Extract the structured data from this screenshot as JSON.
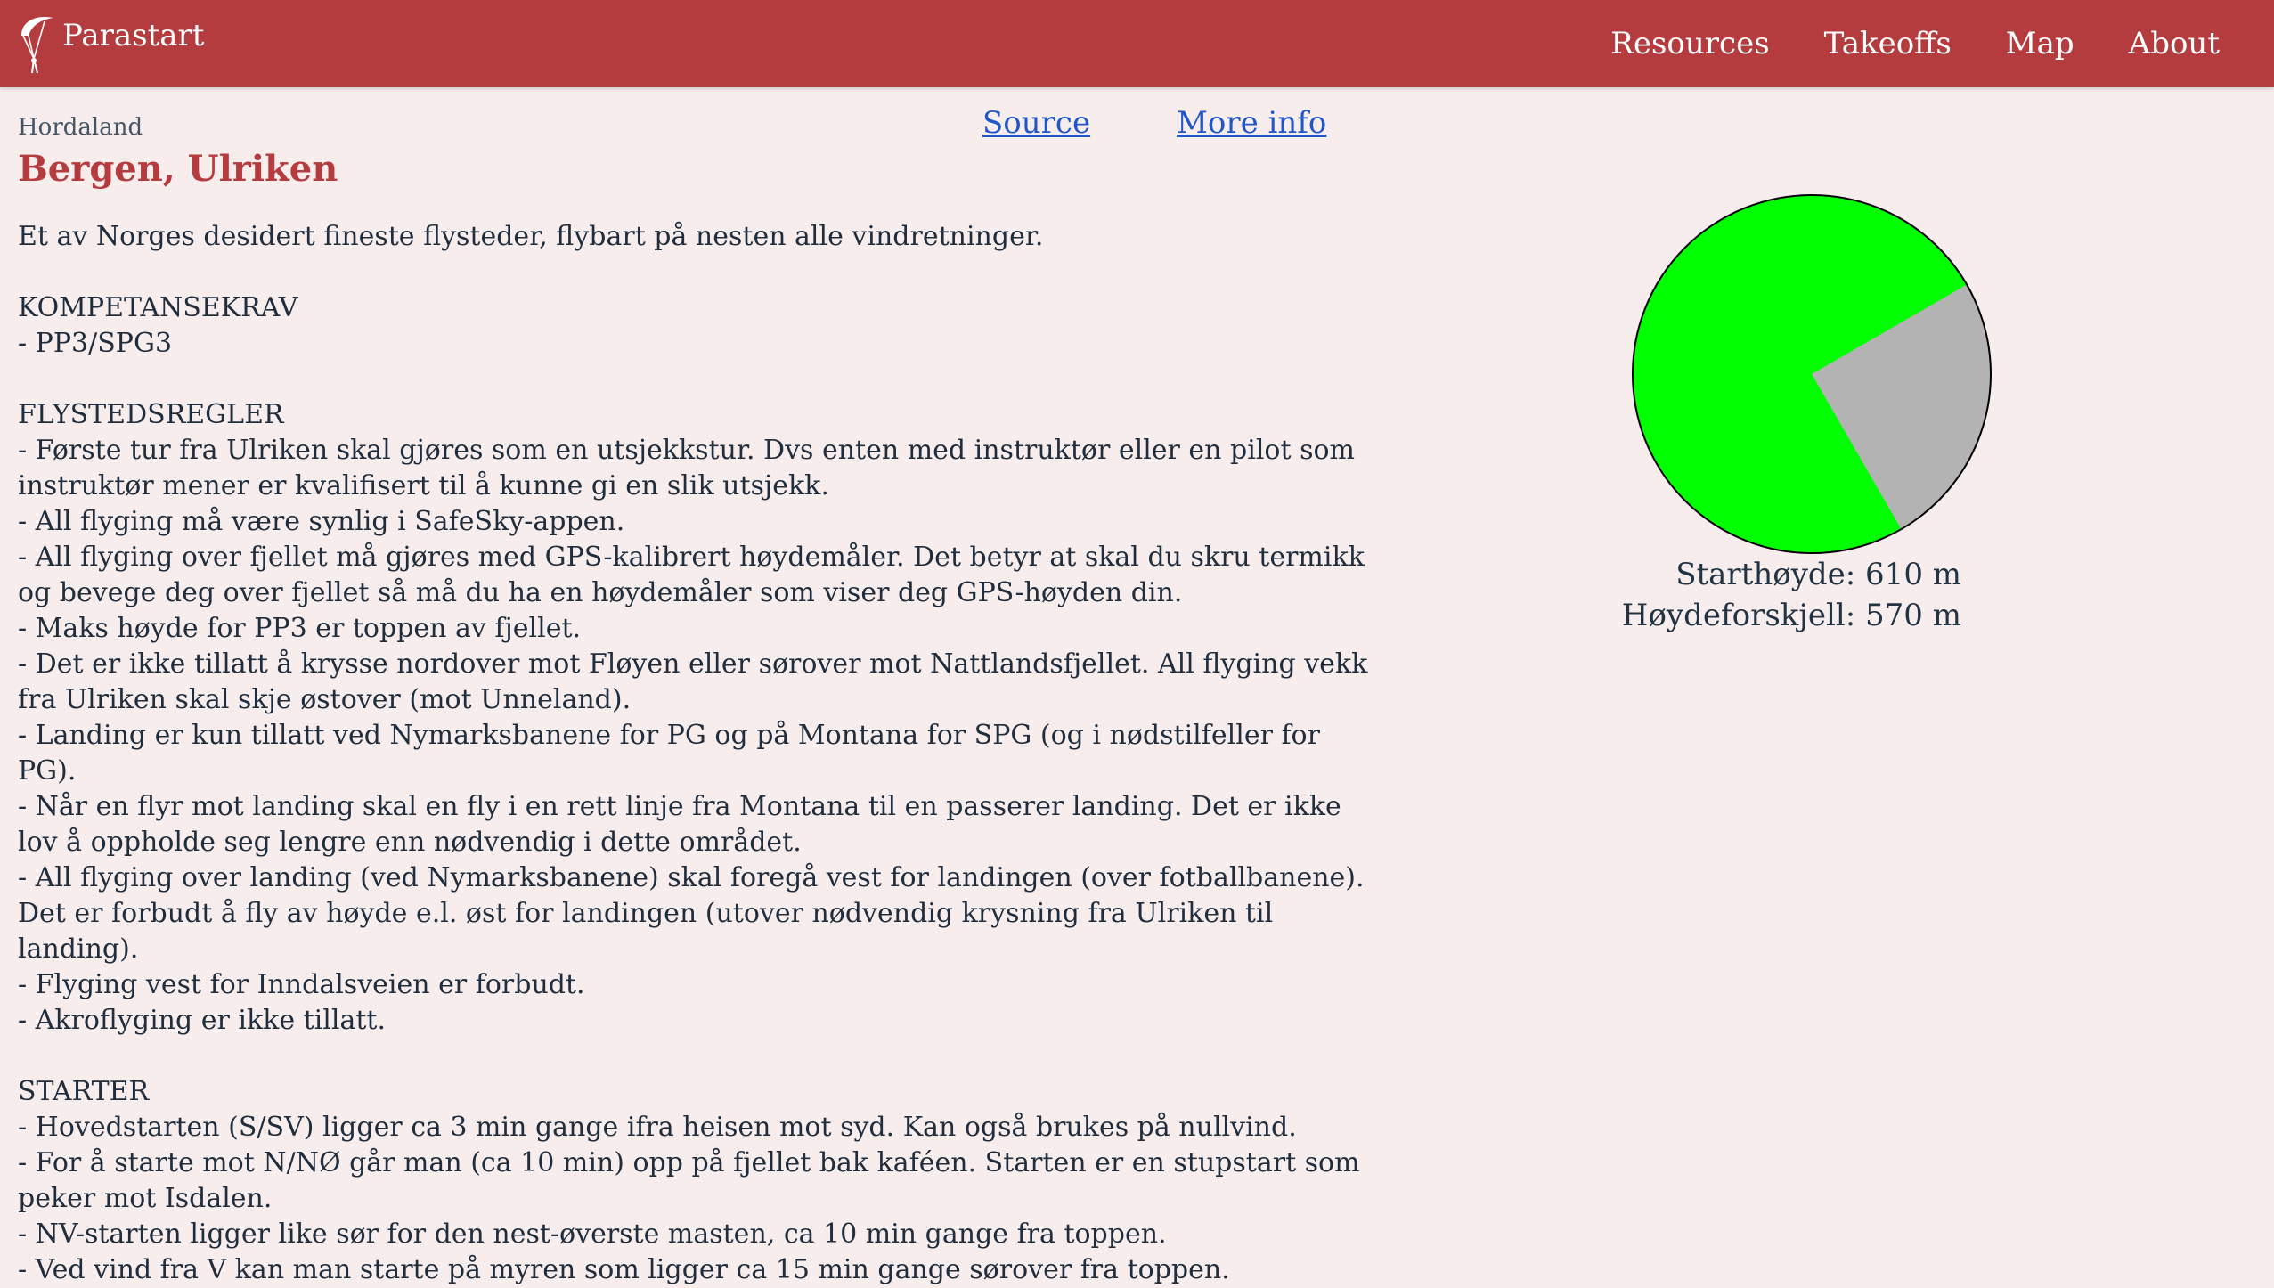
{
  "nav": {
    "brand": "Parastart",
    "items": [
      {
        "label": "Resources"
      },
      {
        "label": "Takeoffs"
      },
      {
        "label": "Map"
      },
      {
        "label": "About"
      }
    ]
  },
  "page": {
    "region": "Hordaland",
    "title": "Bergen, Ulriken",
    "links": {
      "source": "Source",
      "more_info": "More info"
    },
    "intro": "Et av Norges desidert fineste flysteder, flybart på nesten alle vindretninger.",
    "sections": [
      {
        "heading": "KOMPETANSEKRAV",
        "lines": [
          "- PP3/SPG3"
        ]
      },
      {
        "heading": "FLYSTEDSREGLER",
        "lines": [
          "- Første tur fra Ulriken skal gjøres som en utsjekkstur. Dvs enten med instruktør eller en pilot som instruktør mener er kvalifisert til å kunne gi en slik utsjekk.",
          "- All flyging må være synlig i SafeSky-appen.",
          "- All flyging over fjellet må gjøres med GPS-kalibrert høydemåler. Det betyr at skal du skru termikk og bevege deg over fjellet så må du ha en høydemåler som viser deg GPS-høyden din.",
          "- Maks høyde for PP3 er toppen av fjellet.",
          "- Det er ikke tillatt å krysse nordover mot Fløyen eller sørover mot Nattlandsfjellet. All flyging vekk fra Ulriken skal skje østover (mot Unneland).",
          "- Landing er kun tillatt ved Nymarksbanene for PG og på Montana for SPG (og i nødstilfeller for PG).",
          "- Når en flyr mot landing skal en fly i en rett linje fra Montana til en passerer landing. Det er ikke lov å oppholde seg lengre enn nødvendig i dette området.",
          "- All flyging over landing (ved Nymarksbanene) skal foregå vest for landingen (over fotballbanene). Det er forbudt å fly av høyde e.l. øst for landingen (utover nødvendig krysning fra Ulriken til landing).",
          "- Flyging vest for Inndalsveien er forbudt.",
          "- Akroflyging er ikke tillatt."
        ]
      },
      {
        "heading": "STARTER",
        "lines": [
          "- Hovedstarten (S/SV) ligger ca 3 min gange ifra heisen mot syd. Kan også brukes på nullvind.",
          "- For å starte mot N/NØ går man (ca 10 min) opp på fjellet bak kaféen. Starten er en stupstart som peker mot Isdalen.",
          "- NV-starten ligger like sør for den nest-øverste masten, ca 10 min gange fra toppen.",
          "- Ved vind fra V kan man starte på myren som ligger ca 15 min gange sørover fra toppen."
        ]
      }
    ],
    "wind_rose": {
      "colors": {
        "flyable": "#00ff00",
        "not_flyable": "#b3b3b3"
      },
      "not_flyable_sector_deg": [
        60,
        150
      ]
    },
    "takeoff_altitude": "Starthøyde: 610 m",
    "height_difference": "Høydeforskjell: 570 m"
  }
}
